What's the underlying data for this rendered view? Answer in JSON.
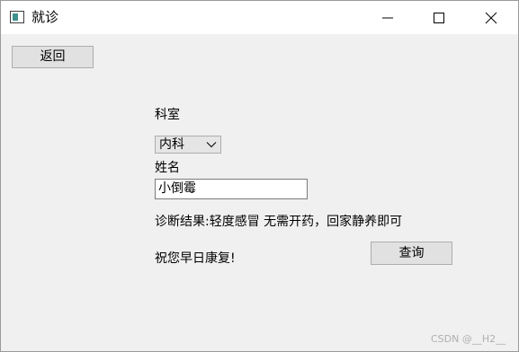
{
  "window": {
    "title": "就诊",
    "icon": "window-app-icon"
  },
  "controls": {
    "minimize_icon": "minimize-icon",
    "maximize_icon": "maximize-icon",
    "close_icon": "close-icon"
  },
  "buttons": {
    "back_label": "返回",
    "query_label": "查询"
  },
  "form": {
    "department_label": "科室",
    "department_value": "内科",
    "name_label": "姓名",
    "name_value": "小倒霉"
  },
  "result": {
    "diagnosis_text": "诊断结果:轻度感冒 无需开药，回家静养即可",
    "wish_text": "祝您早日康复!"
  },
  "watermark": "CSDN @__H2__"
}
